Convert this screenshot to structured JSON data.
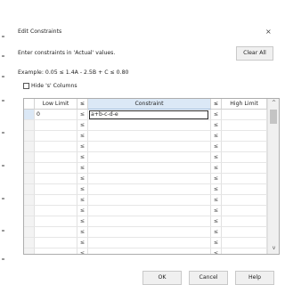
{
  "dialog": {
    "title": "Edit Constraints",
    "close_glyph": "×",
    "instruction": "Enter constraints in 'Actual' values.",
    "example": "Example: 0.05 ≤ 1.4A - 2.5B + C ≤ 0.80",
    "clear_all_label": "Clear All",
    "hide_s_columns": {
      "label": "Hide 's' Columns",
      "checked": false
    }
  },
  "grid": {
    "headers": {
      "low": "Low Limit",
      "s1": "≤",
      "constraint": "Constraint",
      "s2": "≤",
      "high": "High Limit"
    },
    "rows": [
      {
        "low": "0",
        "s1": "≤",
        "constraint": "a+b-c-d-e",
        "s2": "≤",
        "high": ""
      },
      {
        "low": "",
        "s1": "≤",
        "constraint": "",
        "s2": "≤",
        "high": ""
      },
      {
        "low": "",
        "s1": "≤",
        "constraint": "",
        "s2": "≤",
        "high": ""
      },
      {
        "low": "",
        "s1": "≤",
        "constraint": "",
        "s2": "≤",
        "high": ""
      },
      {
        "low": "",
        "s1": "≤",
        "constraint": "",
        "s2": "≤",
        "high": ""
      },
      {
        "low": "",
        "s1": "≤",
        "constraint": "",
        "s2": "≤",
        "high": ""
      },
      {
        "low": "",
        "s1": "≤",
        "constraint": "",
        "s2": "≤",
        "high": ""
      },
      {
        "low": "",
        "s1": "≤",
        "constraint": "",
        "s2": "≤",
        "high": ""
      },
      {
        "low": "",
        "s1": "≤",
        "constraint": "",
        "s2": "≤",
        "high": ""
      },
      {
        "low": "",
        "s1": "≤",
        "constraint": "",
        "s2": "≤",
        "high": ""
      },
      {
        "low": "",
        "s1": "≤",
        "constraint": "",
        "s2": "≤",
        "high": ""
      },
      {
        "low": "",
        "s1": "≤",
        "constraint": "",
        "s2": "≤",
        "high": ""
      },
      {
        "low": "",
        "s1": "≤",
        "constraint": "",
        "s2": "≤",
        "high": ""
      },
      {
        "low": "",
        "s1": "≤",
        "constraint": "",
        "s2": "≤",
        "high": ""
      }
    ],
    "scroll_up_glyph": "^",
    "scroll_down_glyph": "v"
  },
  "footer": {
    "ok_label": "OK",
    "cancel_label": "Cancel",
    "help_label": "Help"
  },
  "colors": {
    "accent_header": "#dbe8f6",
    "button_face": "#f0f0f0"
  }
}
